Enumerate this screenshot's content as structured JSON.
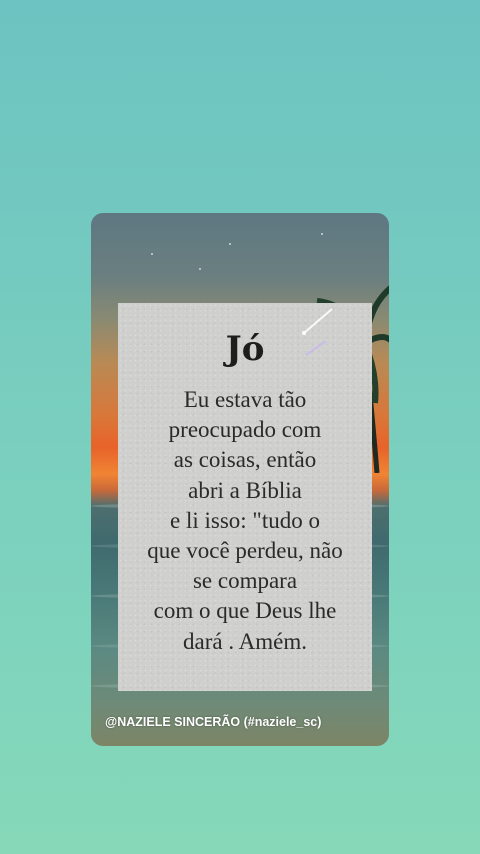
{
  "card": {
    "title": "Jó",
    "lines": [
      "Eu estava tão",
      "preocupado com",
      "as coisas, então",
      "abri a Bíblia",
      "e li isso: \"tudo o",
      "que você perdeu, não",
      "se compara",
      "com o que Deus lhe",
      "dará . Amém."
    ],
    "credit": "@NAZIELE SINCERÃO   (#naziele_sc)"
  },
  "icons": {
    "palm": "palm-tree-icon",
    "sparkle": "shooting-star-icon"
  }
}
